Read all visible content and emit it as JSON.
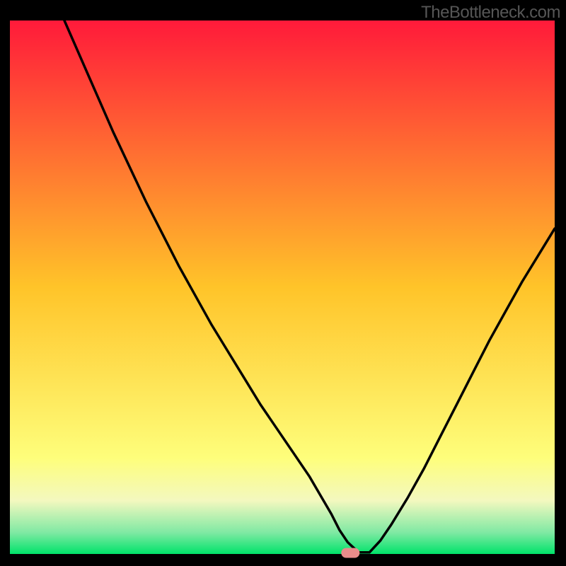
{
  "watermark": "TheBottleneck.com",
  "colors": {
    "gradient_top": "#FF1A3A",
    "gradient_mid": "#FFC429",
    "gradient_low": "#FEFE7B",
    "gradient_cream": "#F3F8BF",
    "gradient_mint": "#7FE9A3",
    "gradient_green": "#00E36A",
    "curve": "#000000",
    "marker_fill": "#E98C8B",
    "frame": "#000000"
  },
  "chart_data": {
    "type": "line",
    "title": "",
    "xlabel": "",
    "ylabel": "",
    "xlim": [
      0,
      100
    ],
    "ylim": [
      0,
      100
    ],
    "series": [
      {
        "name": "bottleneck-curve",
        "x": [
          10,
          13,
          16,
          19,
          22,
          25,
          28,
          31,
          34,
          37,
          40,
          43,
          46,
          49,
          52,
          55,
          57,
          59,
          60.5,
          62,
          64,
          66,
          68,
          70,
          73,
          76,
          79,
          82,
          85,
          88,
          91,
          94,
          97,
          100
        ],
        "values": [
          100,
          93,
          86,
          79,
          72.5,
          66,
          60,
          54,
          48.5,
          43,
          38,
          33,
          28,
          23.5,
          19,
          14.5,
          11,
          7.5,
          4.5,
          2.2,
          0.3,
          0.3,
          2.5,
          5.5,
          10.5,
          16,
          22,
          28,
          34,
          40,
          45.5,
          51,
          56,
          61
        ]
      }
    ],
    "annotations": [
      {
        "type": "marker",
        "x": 62.5,
        "y": 0.2,
        "label": "optimal-point"
      }
    ]
  }
}
